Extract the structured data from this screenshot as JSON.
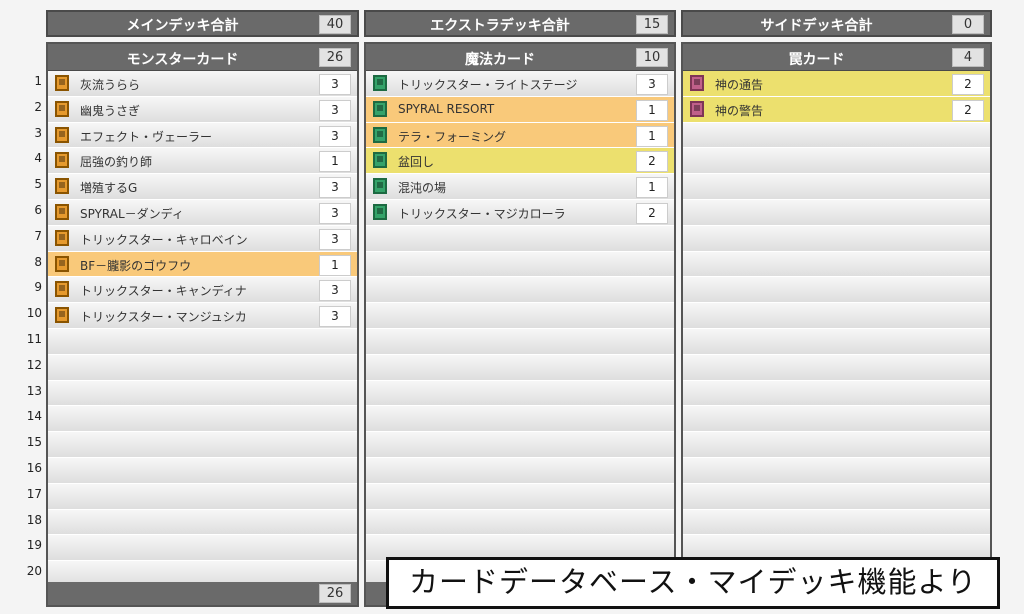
{
  "totals": {
    "main": {
      "label": "メインデッキ合計",
      "count": "40"
    },
    "extra": {
      "label": "エクストラデッキ合計",
      "count": "15"
    },
    "side": {
      "label": "サイドデッキ合計",
      "count": "0"
    }
  },
  "row_numbers": [
    "1",
    "2",
    "3",
    "4",
    "5",
    "6",
    "7",
    "8",
    "9",
    "10",
    "11",
    "12",
    "13",
    "14",
    "15",
    "16",
    "17",
    "18",
    "19",
    "20"
  ],
  "monster": {
    "label": "モンスターカード",
    "count": "26",
    "footer_count": "26",
    "cards": [
      {
        "name": "灰流うらら",
        "qty": "3",
        "highlight": ""
      },
      {
        "name": "幽鬼うさぎ",
        "qty": "3",
        "highlight": ""
      },
      {
        "name": "エフェクト・ヴェーラー",
        "qty": "3",
        "highlight": ""
      },
      {
        "name": "屈強の釣り師",
        "qty": "1",
        "highlight": ""
      },
      {
        "name": "増殖するG",
        "qty": "3",
        "highlight": ""
      },
      {
        "name": "SPYRAL－ダンディ",
        "qty": "3",
        "highlight": ""
      },
      {
        "name": "トリックスター・キャロベイン",
        "qty": "3",
        "highlight": ""
      },
      {
        "name": "BF－朧影のゴウフウ",
        "qty": "1",
        "highlight": "orange"
      },
      {
        "name": "トリックスター・キャンディナ",
        "qty": "3",
        "highlight": ""
      },
      {
        "name": "トリックスター・マンジュシカ",
        "qty": "3",
        "highlight": ""
      }
    ]
  },
  "spell": {
    "label": "魔法カード",
    "count": "10",
    "cards": [
      {
        "name": "トリックスター・ライトステージ",
        "qty": "3",
        "highlight": ""
      },
      {
        "name": "SPYRAL RESORT",
        "qty": "1",
        "highlight": "orange"
      },
      {
        "name": "テラ・フォーミング",
        "qty": "1",
        "highlight": "orange"
      },
      {
        "name": "盆回し",
        "qty": "2",
        "highlight": "yellow"
      },
      {
        "name": "混沌の場",
        "qty": "1",
        "highlight": ""
      },
      {
        "name": "トリックスター・マジカローラ",
        "qty": "2",
        "highlight": ""
      }
    ]
  },
  "trap": {
    "label": "罠カード",
    "count": "4",
    "cards": [
      {
        "name": "神の通告",
        "qty": "2",
        "highlight": "yellow"
      },
      {
        "name": "神の警告",
        "qty": "2",
        "highlight": "yellow"
      }
    ]
  },
  "caption": "カードデータベース・マイデッキ機能より"
}
